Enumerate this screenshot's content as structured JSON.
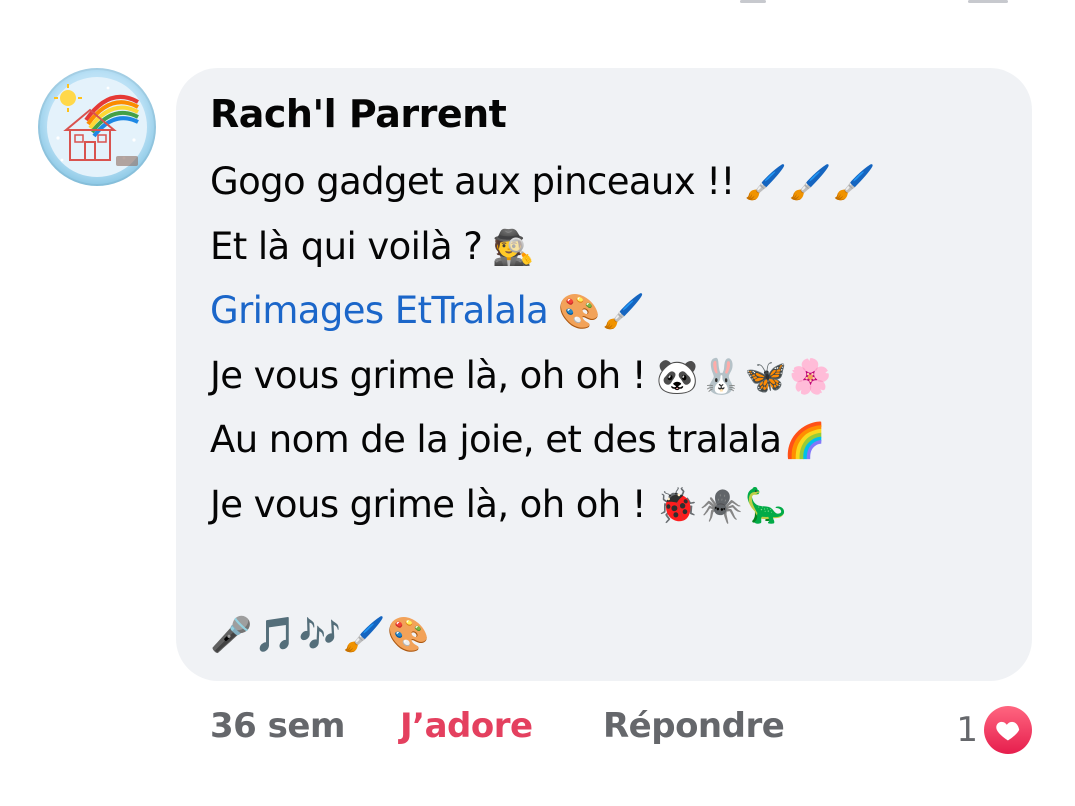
{
  "comment": {
    "author": "Rach'l Parrent",
    "lines": [
      {
        "text": "Gogo gadget aux pinceaux !!",
        "emoji": "🖌️🖌️🖌️"
      },
      {
        "text": "Et là qui voilà ?",
        "emoji": "🕵️"
      },
      {
        "mention": "Grimages EtTralala",
        "emoji": "🎨🖌️"
      },
      {
        "text": "Je vous grime là, oh oh !",
        "emoji": "🐼🐰🦋🌸"
      },
      {
        "text": "Au nom de la joie, et des tralala",
        "emoji": "🌈"
      },
      {
        "text": "Je vous grime là, oh oh !",
        "emoji": "🐞🕷️🦕"
      },
      {
        "text": "",
        "emoji": ""
      },
      {
        "text": "",
        "emoji": "🎤🎵🎶🖌️🎨"
      }
    ]
  },
  "footer": {
    "time": "36 sem",
    "like_label": "J’adore",
    "reply_label": "Répondre",
    "reaction_count": "1"
  },
  "colors": {
    "bubble": "#f0f2f5",
    "mention": "#1b66c9",
    "like": "#e4405f",
    "meta": "#65676b"
  },
  "icons": {
    "avatar": "profile-picture",
    "reaction": "heart-reaction-icon"
  }
}
